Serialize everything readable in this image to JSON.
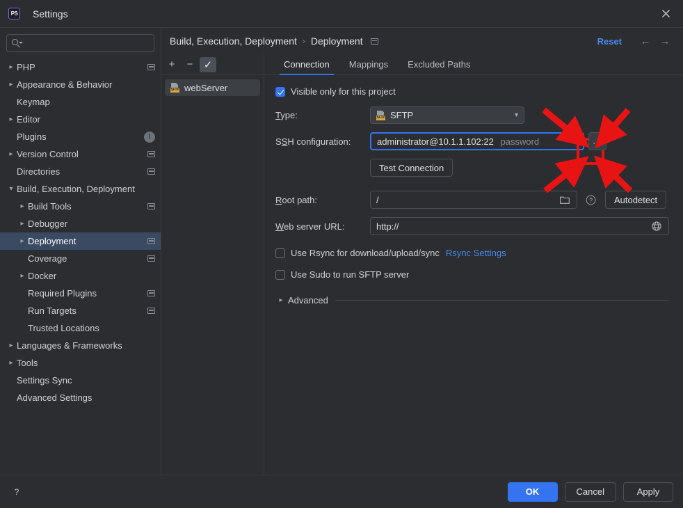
{
  "window": {
    "title": "Settings",
    "app_icon": "PS",
    "close_icon": "close-icon"
  },
  "sidebar": {
    "search": {
      "value": "",
      "placeholder": ""
    },
    "items": [
      {
        "label": "PHP",
        "arrow": "collapsed",
        "indent": 0,
        "restore": true,
        "badge": null,
        "selected": false
      },
      {
        "label": "Appearance & Behavior",
        "arrow": "collapsed",
        "indent": 0,
        "restore": false,
        "badge": null,
        "selected": false
      },
      {
        "label": "Keymap",
        "arrow": "none",
        "indent": 0,
        "restore": false,
        "badge": null,
        "selected": false
      },
      {
        "label": "Editor",
        "arrow": "collapsed",
        "indent": 0,
        "restore": false,
        "badge": null,
        "selected": false
      },
      {
        "label": "Plugins",
        "arrow": "none",
        "indent": 0,
        "restore": false,
        "badge": "1",
        "selected": false
      },
      {
        "label": "Version Control",
        "arrow": "collapsed",
        "indent": 0,
        "restore": true,
        "badge": null,
        "selected": false
      },
      {
        "label": "Directories",
        "arrow": "none",
        "indent": 0,
        "restore": true,
        "badge": null,
        "selected": false
      },
      {
        "label": "Build, Execution, Deployment",
        "arrow": "expanded",
        "indent": 0,
        "restore": false,
        "badge": null,
        "selected": false
      },
      {
        "label": "Build Tools",
        "arrow": "collapsed",
        "indent": 1,
        "restore": true,
        "badge": null,
        "selected": false
      },
      {
        "label": "Debugger",
        "arrow": "collapsed",
        "indent": 1,
        "restore": false,
        "badge": null,
        "selected": false
      },
      {
        "label": "Deployment",
        "arrow": "collapsed",
        "indent": 1,
        "restore": true,
        "badge": null,
        "selected": true
      },
      {
        "label": "Coverage",
        "arrow": "none",
        "indent": 1,
        "restore": true,
        "badge": null,
        "selected": false
      },
      {
        "label": "Docker",
        "arrow": "collapsed",
        "indent": 1,
        "restore": false,
        "badge": null,
        "selected": false
      },
      {
        "label": "Required Plugins",
        "arrow": "none",
        "indent": 1,
        "restore": true,
        "badge": null,
        "selected": false
      },
      {
        "label": "Run Targets",
        "arrow": "none",
        "indent": 1,
        "restore": true,
        "badge": null,
        "selected": false
      },
      {
        "label": "Trusted Locations",
        "arrow": "none",
        "indent": 1,
        "restore": false,
        "badge": null,
        "selected": false
      },
      {
        "label": "Languages & Frameworks",
        "arrow": "collapsed",
        "indent": 0,
        "restore": false,
        "badge": null,
        "selected": false
      },
      {
        "label": "Tools",
        "arrow": "collapsed",
        "indent": 0,
        "restore": false,
        "badge": null,
        "selected": false
      },
      {
        "label": "Settings Sync",
        "arrow": "none",
        "indent": 0,
        "restore": false,
        "badge": null,
        "selected": false
      },
      {
        "label": "Advanced Settings",
        "arrow": "none",
        "indent": 0,
        "restore": false,
        "badge": null,
        "selected": false
      }
    ]
  },
  "header": {
    "breadcrumb_root": "Build, Execution, Deployment",
    "breadcrumb_sep": "›",
    "breadcrumb_leaf": "Deployment",
    "reset_label": "Reset",
    "back_arrow": "←",
    "forward_arrow": "→"
  },
  "servers": {
    "toolbar": {
      "add": "+",
      "remove": "−",
      "check": "✓"
    },
    "items": [
      {
        "name": "webServer",
        "type_badge": "SFTP",
        "selected": true
      }
    ]
  },
  "tabs": [
    {
      "label": "Connection",
      "active": true
    },
    {
      "label": "Mappings",
      "active": false
    },
    {
      "label": "Excluded Paths",
      "active": false
    }
  ],
  "form": {
    "visible_only_label": "Visible only for this project",
    "visible_only_checked": true,
    "type_label": "Type:",
    "type_mnemonic": "T",
    "type_value": "SFTP",
    "type_badge": "SFTP",
    "ssh_label_pre": "S",
    "ssh_label_mnemonic": "S",
    "ssh_label_post": "H configuration:",
    "ssh_label_full": "SSH configuration:",
    "ssh_value": "administrator@10.1.1.102:22",
    "ssh_auth_hint": "password",
    "ssh_browse_label": "...",
    "test_connection_label": "Test Connection",
    "root_path_label": "Root path:",
    "root_path_value": "/",
    "root_path_folder_icon": "folder-icon",
    "root_path_help_icon": "help-icon",
    "autodetect_label": "Autodetect",
    "web_url_label": "Web server URL:",
    "web_url_value": "http://",
    "web_url_globe_icon": "globe-icon",
    "rsync_label": "Use Rsync for download/upload/sync",
    "rsync_checked": false,
    "rsync_settings_link": "Rsync Settings",
    "sudo_label": "Use Sudo to run SFTP server",
    "sudo_checked": false,
    "advanced_label": "Advanced"
  },
  "footer": {
    "help_icon": "?",
    "ok_label": "OK",
    "cancel_label": "Cancel",
    "apply_label": "Apply"
  },
  "annotation": {
    "highlight_color": "#e81414",
    "arrow_count": 4,
    "target": "ssh-configuration-browse-button"
  }
}
